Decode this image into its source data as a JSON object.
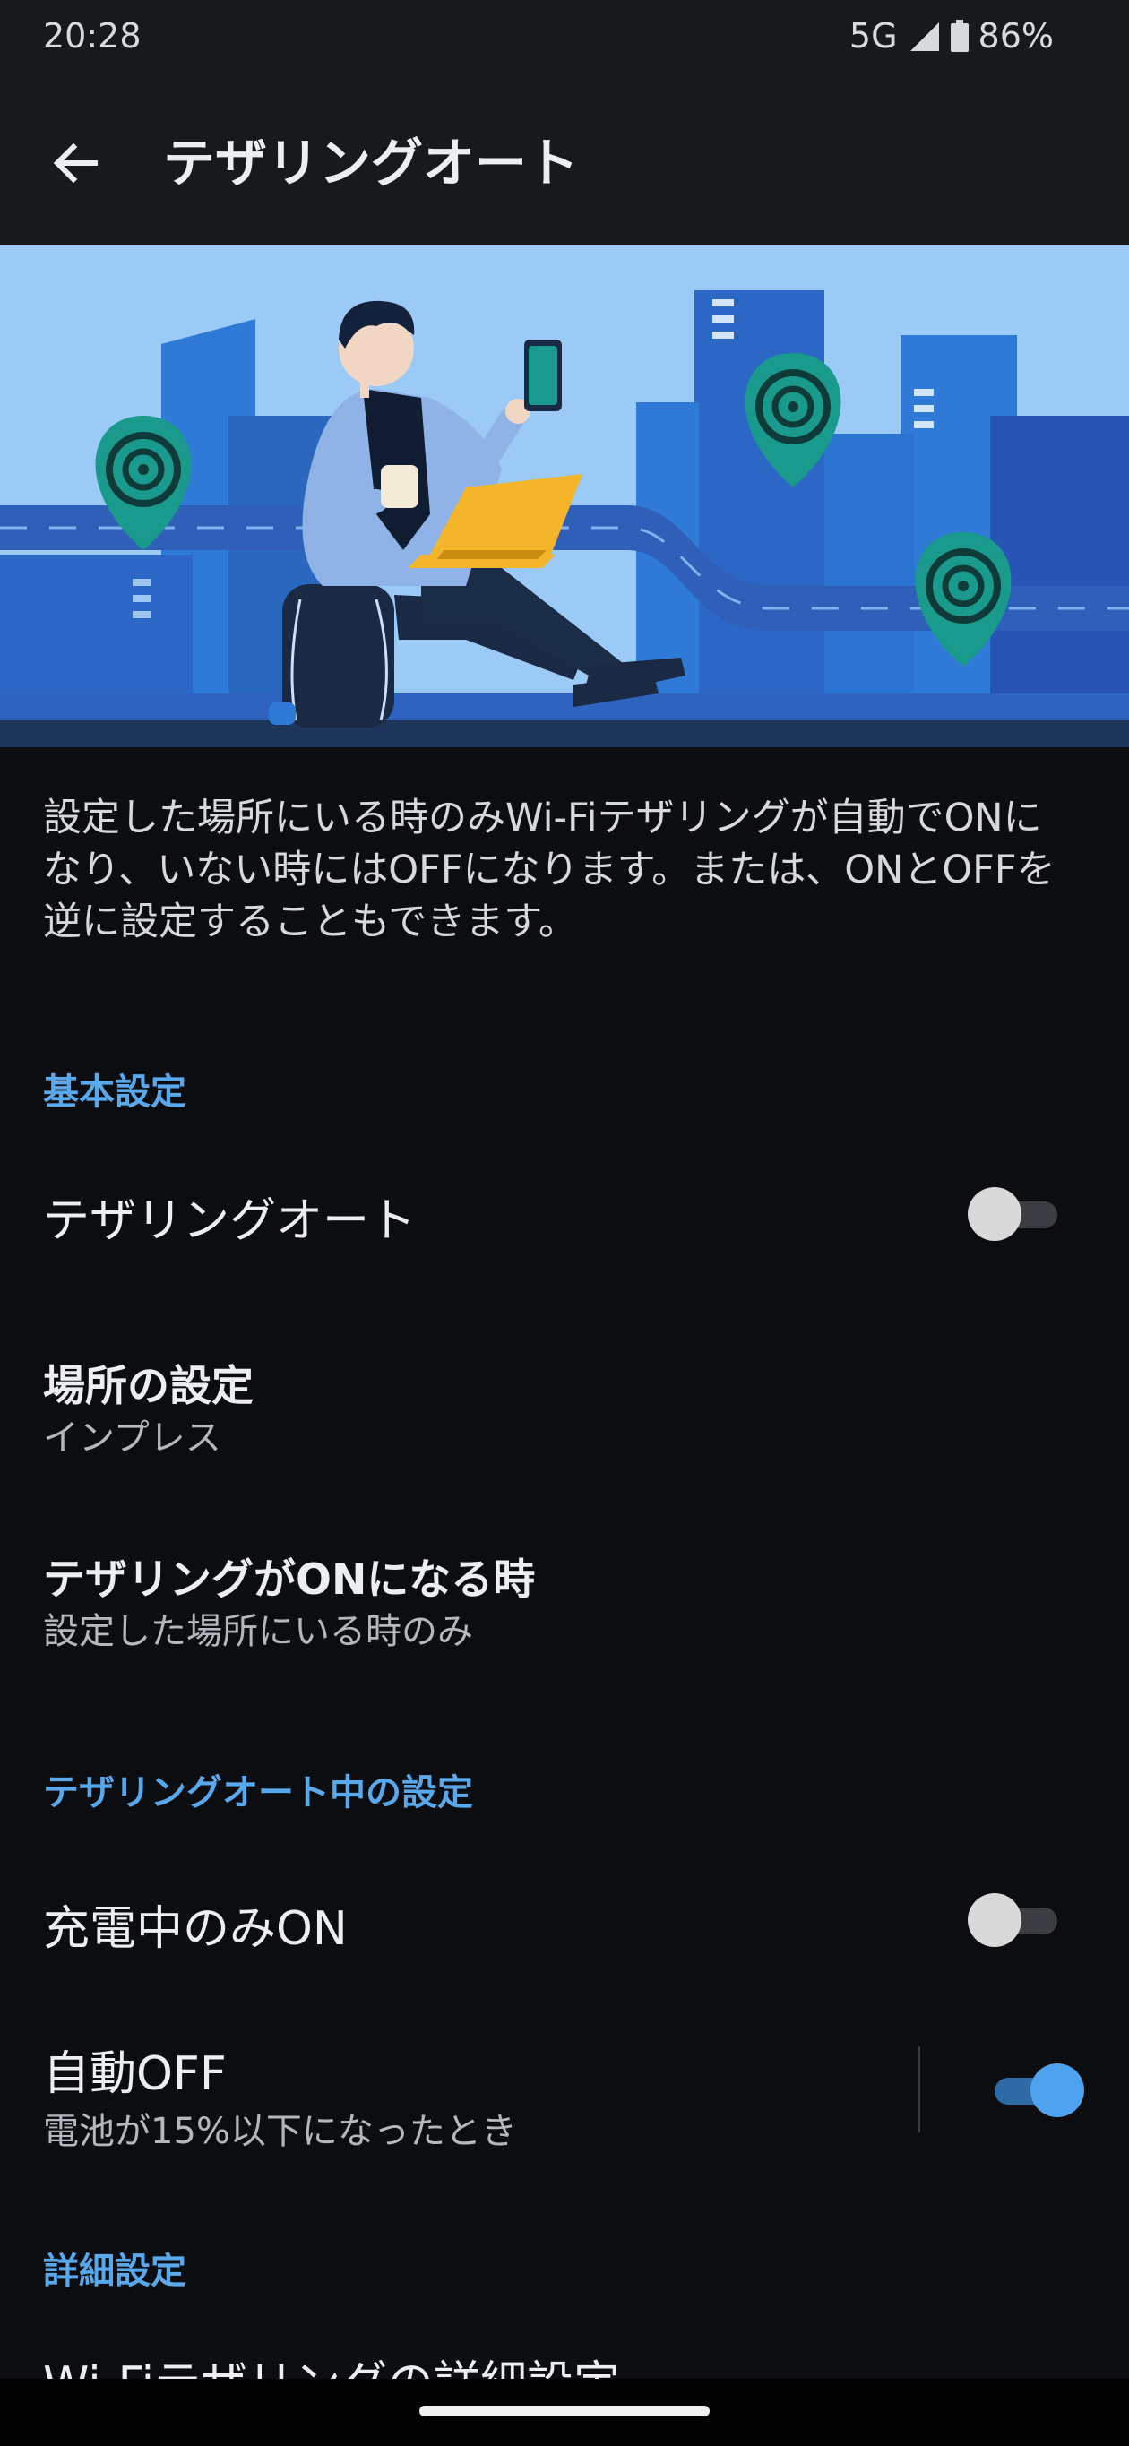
{
  "status": {
    "time": "20:28",
    "network": "5G",
    "battery": "86%"
  },
  "app_bar": {
    "title": "テザリングオート"
  },
  "description": "設定した場所にいる時のみWi-Fiテザリングが自動でONになり、いない時にはOFFになります。または、ONとOFFを逆に設定することもできます。",
  "sections": {
    "basic": "基本設定",
    "during": "テザリングオート中の設定",
    "advanced": "詳細設定"
  },
  "rows": {
    "tethering_auto": {
      "title": "テザリングオート",
      "enabled": false
    },
    "location": {
      "title": "場所の設定",
      "subtitle": "インプレス"
    },
    "when_on": {
      "title": "テザリングがONになる時",
      "subtitle": "設定した場所にいる時のみ"
    },
    "charging_only": {
      "title": "充電中のみON",
      "enabled": false
    },
    "auto_off": {
      "title": "自動OFF",
      "subtitle": "電池が15%以下になったとき",
      "enabled": true
    },
    "wifi_detail": {
      "title": "Wi-Fiテザリングの詳細設定"
    }
  },
  "colors": {
    "accent": "#5aa8ec",
    "background": "#0c0d10",
    "bar": "#17191d",
    "switch_on": "#4ea2ee"
  }
}
